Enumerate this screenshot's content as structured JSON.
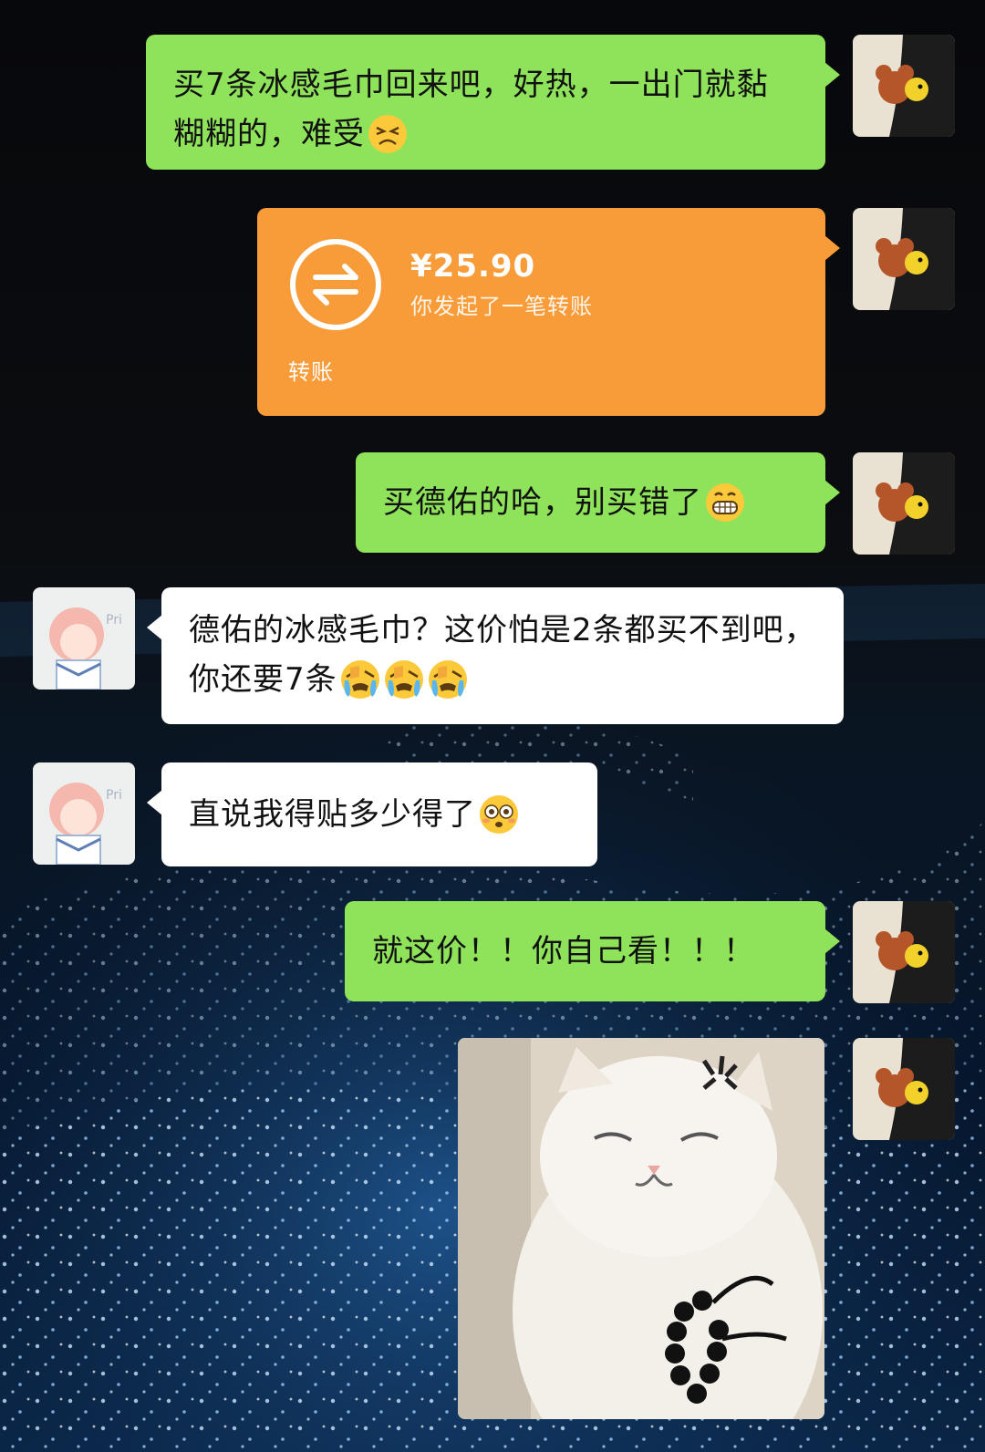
{
  "colors": {
    "sent_bubble": "#8ee35b",
    "received_bubble": "#ffffff",
    "transfer_bubble": "#f89c3a",
    "background": "#050608"
  },
  "messages": [
    {
      "side": "right",
      "text": "买7条冰感毛巾回来吧，好热，一出门就黏糊糊的，难受",
      "emoji": [
        "persevering-face-icon"
      ]
    },
    {
      "side": "right",
      "type": "transfer",
      "amount": "¥25.90",
      "description": "你发起了一笔转账",
      "label": "转账"
    },
    {
      "side": "right",
      "text": "买德佑的哈，别买错了",
      "emoji": [
        "grinning-face-icon"
      ]
    },
    {
      "side": "left",
      "text": "德佑的冰感毛巾？这价怕是2条都买不到吧，你还要7条",
      "emoji": [
        "crying-face-icon",
        "crying-face-icon",
        "crying-face-icon"
      ]
    },
    {
      "side": "left",
      "text": "直说我得贴多少得了",
      "emoji": [
        "flushed-face-icon"
      ]
    },
    {
      "side": "right",
      "text": "就这价！！你自己看！！！"
    },
    {
      "side": "right",
      "type": "image",
      "image": "angry-cat-sticker"
    }
  ],
  "avatars": {
    "self": "cartoon-mouse-and-bird-avatar",
    "other": "pink-hair-girl-avatar"
  }
}
